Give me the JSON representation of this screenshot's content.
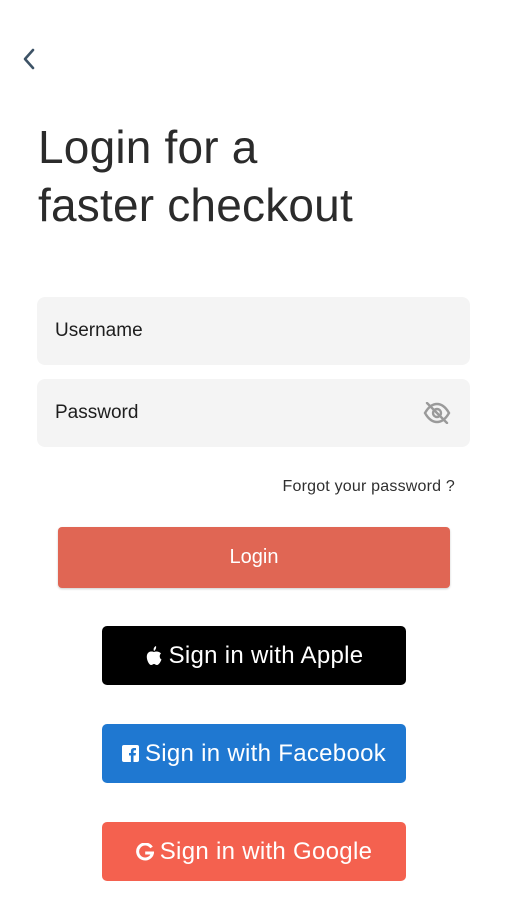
{
  "header": {
    "title_line1": "Login for a",
    "title_line2": "faster checkout"
  },
  "form": {
    "username_placeholder": "Username",
    "password_placeholder": "Password",
    "forgot_label": "Forgot your password ?",
    "login_label": "Login"
  },
  "social": {
    "apple_label": "Sign in with Apple",
    "facebook_label": "Sign in with Facebook",
    "google_label": "Sign in with Google"
  },
  "icons": {
    "back": "chevron-left-icon",
    "password_toggle": "eye-off-icon",
    "apple": "apple-icon",
    "facebook": "facebook-icon",
    "google": "google-icon"
  },
  "colors": {
    "login_button": "#e06654",
    "apple_button": "#000000",
    "facebook_button": "#1f78d1",
    "google_button": "#f4614f",
    "field_background": "#f4f4f4"
  }
}
